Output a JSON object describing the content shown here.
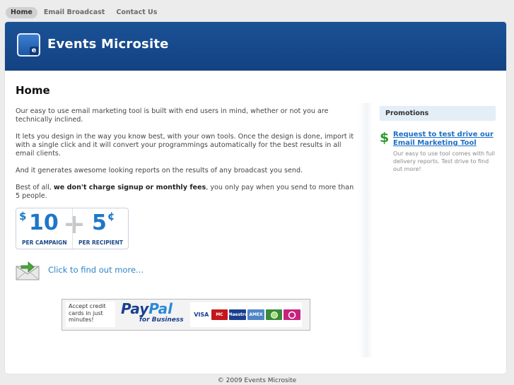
{
  "nav": {
    "items": [
      {
        "label": "Home",
        "active": true
      },
      {
        "label": "Email Broadcast",
        "active": false
      },
      {
        "label": "Contact Us",
        "active": false
      }
    ]
  },
  "header": {
    "logo_letter": "e",
    "site_title": "Events Microsite"
  },
  "main": {
    "page_title": "Home",
    "paragraphs": [
      "Our easy to use email marketing tool is built with end users in mind, whether or not you are technically inclined.",
      "It lets you design in the way you know best, with your own tools. Once the design is done, import it with a single click and it will convert your programmings automatically for the best results in all email clients.",
      "And it generates awesome looking reports on the results of any broadcast you send."
    ],
    "fees_prefix": "Best of all, ",
    "fees_bold": "we don't charge signup or monthly fees",
    "fees_suffix": ", you only pay when you send to more than 5 people.",
    "pricing": {
      "campaign_symbol": "$",
      "campaign_amount": "10",
      "campaign_caption": "PER CAMPAIGN",
      "plus": "+",
      "recipient_amount": "5",
      "recipient_symbol": "¢",
      "recipient_caption": "PER RECIPIENT"
    },
    "more_link": "Click to find out more...",
    "paypal": {
      "accept_text": "Accept credit cards in just minutes!",
      "logo_pay": "Pay",
      "logo_pal": "Pal",
      "logo_sub": "for Business",
      "cards": [
        "VISA",
        "MC",
        "Maestro",
        "AMEX",
        "",
        ""
      ]
    }
  },
  "sidebar": {
    "heading": "Promotions",
    "promo_link": "Request to test drive our Email Marketing Tool",
    "promo_desc": "Our easy to use tool comes with full delivery reports. Test drive to find out more!",
    "icon": "dollar-icon"
  },
  "footer": {
    "copyright": "© 2009 Events Microsite"
  },
  "colors": {
    "header_bg": "#164a8b",
    "link": "#2d84c8",
    "price_blue": "#1e77c8"
  }
}
